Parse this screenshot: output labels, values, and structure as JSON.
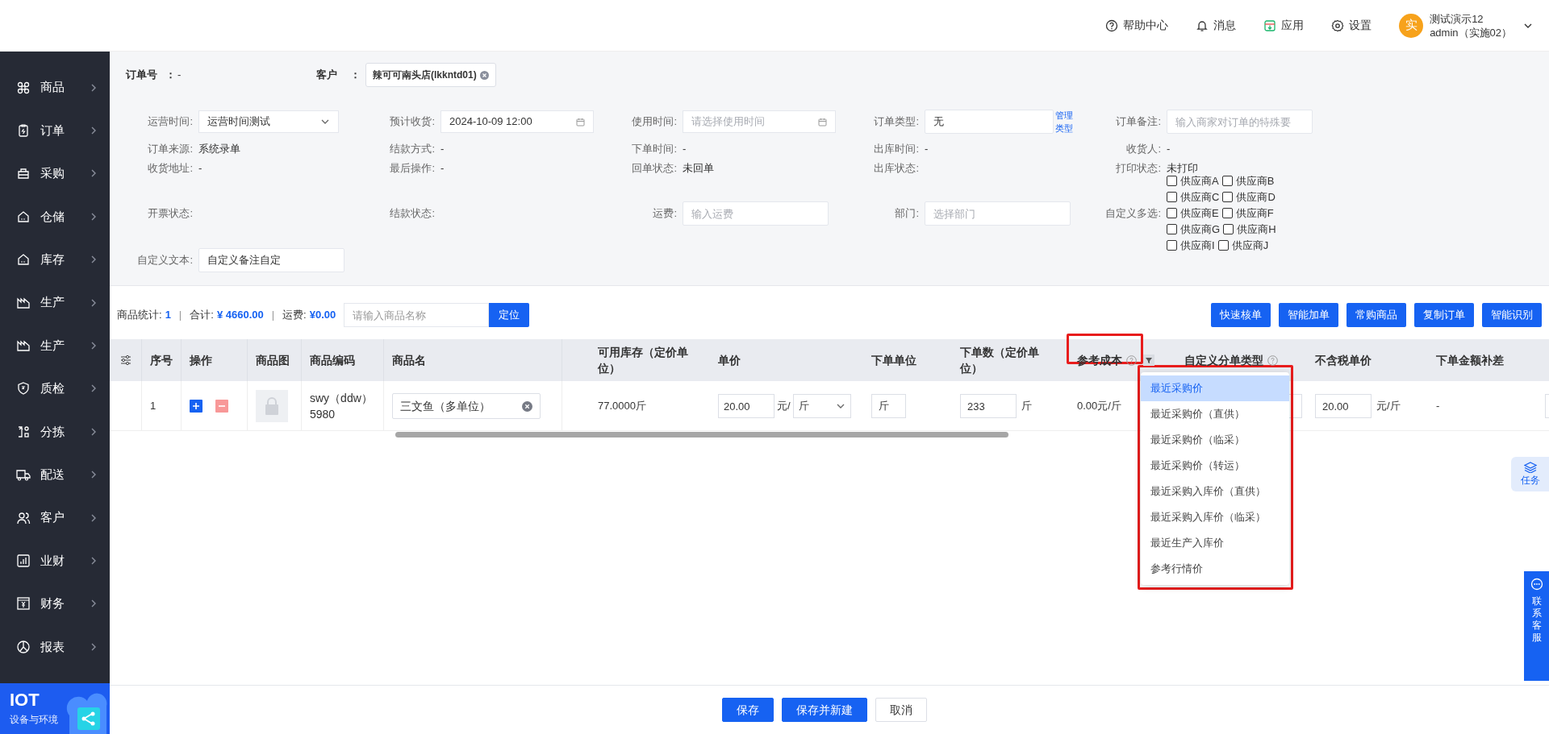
{
  "header": {
    "links": [
      {
        "label": "帮助中心"
      },
      {
        "label": "消息"
      },
      {
        "label": "应用"
      },
      {
        "label": "设置"
      }
    ],
    "user": {
      "avatar": "实",
      "name": "测试演示12",
      "role": "admin（实施02）"
    }
  },
  "sidebar": {
    "items": [
      {
        "label": "商品"
      },
      {
        "label": "订单"
      },
      {
        "label": "采购"
      },
      {
        "label": "仓储"
      },
      {
        "label": "库存"
      },
      {
        "label": "生产"
      },
      {
        "label": "生产"
      },
      {
        "label": "质检"
      },
      {
        "label": "分拣"
      },
      {
        "label": "配送"
      },
      {
        "label": "客户"
      },
      {
        "label": "业财"
      },
      {
        "label": "财务"
      },
      {
        "label": "报表"
      }
    ],
    "banner": {
      "title": "IOT",
      "subtitle": "设备与环境"
    }
  },
  "order": {
    "number_label": "订单号",
    "number_sep": "：",
    "number": "-",
    "customer_label": "客户",
    "customer_sep": "：",
    "customer": "辣可可南头店(lkkntd01)"
  },
  "form": {
    "rows": [
      [
        {
          "label": "运营时间:",
          "kind": "select",
          "value": "运营时间测试"
        },
        {
          "label": "预计收货:",
          "kind": "date",
          "value": "2024-10-09 12:00"
        },
        {
          "label": "使用时间:",
          "kind": "date",
          "placeholder": "请选择使用时间"
        },
        {
          "label": "订单类型:",
          "kind": "input",
          "value": "无",
          "link": "管理类型"
        },
        {
          "label": "订单备注:",
          "kind": "input",
          "placeholder": "输入商家对订单的特殊要"
        }
      ],
      [
        {
          "label": "订单来源:",
          "kind": "text",
          "value": "系统录单"
        },
        {
          "label": "结款方式:",
          "kind": "text",
          "value": "-"
        },
        {
          "label": "下单时间:",
          "kind": "text",
          "value": "-"
        },
        {
          "label": "出库时间:",
          "kind": "text",
          "value": "-"
        },
        {
          "label": "收货人:",
          "kind": "text",
          "value": "-"
        }
      ],
      [
        {
          "label": "收货地址:",
          "kind": "text",
          "value": "-"
        },
        {
          "label": "最后操作:",
          "kind": "text",
          "value": "-"
        },
        {
          "label": "回单状态:",
          "kind": "text",
          "value": "未回单"
        },
        {
          "label": "出库状态:",
          "kind": "text"
        },
        {
          "label": "打印状态:",
          "kind": "text",
          "value": "未打印"
        }
      ],
      [
        {
          "label": "开票状态:",
          "kind": "text"
        },
        {
          "label": "结款状态:",
          "kind": "text"
        },
        {
          "label": "运费:",
          "kind": "input",
          "placeholder": "输入运费"
        },
        {
          "label": "部门:",
          "kind": "input",
          "placeholder": "选择部门"
        },
        {
          "label": "自定义多选:",
          "kind": "checkboxes",
          "options": [
            {
              "label": "供应商A",
              "checked": false
            },
            {
              "label": "供应商B",
              "checked": false
            },
            {
              "label": "供应商C",
              "checked": false
            },
            {
              "label": "供应商D",
              "checked": false
            },
            {
              "label": "供应商E",
              "checked": false
            },
            {
              "label": "供应商F",
              "checked": false
            },
            {
              "label": "供应商G",
              "checked": false
            },
            {
              "label": "供应商H",
              "checked": false
            },
            {
              "label": "供应商I",
              "checked": false
            },
            {
              "label": "供应商J",
              "checked": false
            }
          ]
        }
      ],
      [
        {
          "label": "自定义文本:",
          "kind": "input",
          "value": "自定义备注自定"
        }
      ]
    ]
  },
  "toolbar": {
    "stats": [
      {
        "label": "商品统计:",
        "value": "1"
      },
      {
        "label": "合计:",
        "value": "¥ 4660.00"
      },
      {
        "label": "运费:",
        "value": "¥0.00"
      }
    ],
    "separator": "|",
    "search": {
      "placeholder": "请输入商品名称",
      "button": "定位"
    },
    "buttons": [
      "快速核单",
      "智能加单",
      "常购商品",
      "复制订单",
      "智能识别"
    ]
  },
  "table": {
    "columns": [
      {
        "kind": "settings"
      },
      {
        "label": "序号"
      },
      {
        "label": "操作"
      },
      {
        "label": "商品图"
      },
      {
        "label": "商品编码"
      },
      {
        "label": "商品名"
      },
      {
        "kind": "spacer"
      },
      {
        "label": "可用库存（定价单位）"
      },
      {
        "label": "单价"
      },
      {
        "label": "下单单位"
      },
      {
        "label": "下单数（定价单位）"
      },
      {
        "label": "参考成本",
        "help": true,
        "filter": true
      },
      {
        "label": "自定义分单类型",
        "help": true
      },
      {
        "label": "不含税单价"
      },
      {
        "label": "下单金额补差"
      },
      {
        "kind": "cut"
      }
    ],
    "rows": [
      {
        "cells": [
          {
            "kind": "empty"
          },
          {
            "kind": "text",
            "value": "1"
          },
          {
            "kind": "actions"
          },
          {
            "kind": "image"
          },
          {
            "kind": "text",
            "value": "swy（ddw）5980"
          },
          {
            "kind": "clear-input",
            "value": "三文鱼（多单位）"
          },
          {
            "kind": "empty"
          },
          {
            "kind": "text",
            "value": "77.0000斤"
          },
          {
            "kind": "price",
            "value": "20.00",
            "unit": "元/",
            "select": "斤"
          },
          {
            "kind": "input",
            "value": "斤"
          },
          {
            "kind": "input-unit",
            "value": "233",
            "unit": "斤"
          },
          {
            "kind": "text",
            "value": "0.00元/斤"
          },
          {
            "kind": "input"
          },
          {
            "kind": "input-unit",
            "value": "20.00",
            "unit": "元/斤"
          },
          {
            "kind": "text",
            "value": "-"
          },
          {
            "kind": "input"
          }
        ]
      }
    ]
  },
  "dropdown": {
    "options": [
      {
        "label": "最近采购价",
        "selected": true
      },
      {
        "label": "最近采购价（直供）",
        "selected": false
      },
      {
        "label": "最近采购价（临采）",
        "selected": false
      },
      {
        "label": "最近采购价（转运）",
        "selected": false
      },
      {
        "label": "最近采购入库价（直供）",
        "selected": false
      },
      {
        "label": "最近采购入库价（临采）",
        "selected": false
      },
      {
        "label": "最近生产入库价",
        "selected": false
      },
      {
        "label": "参考行情价",
        "selected": false
      }
    ]
  },
  "floating": {
    "task": "任务",
    "service": "联系客服"
  },
  "footer": {
    "buttons": [
      {
        "label": "保存",
        "kind": "primary"
      },
      {
        "label": "保存并新建",
        "kind": "primary"
      },
      {
        "label": "取消",
        "kind": "default"
      }
    ]
  }
}
